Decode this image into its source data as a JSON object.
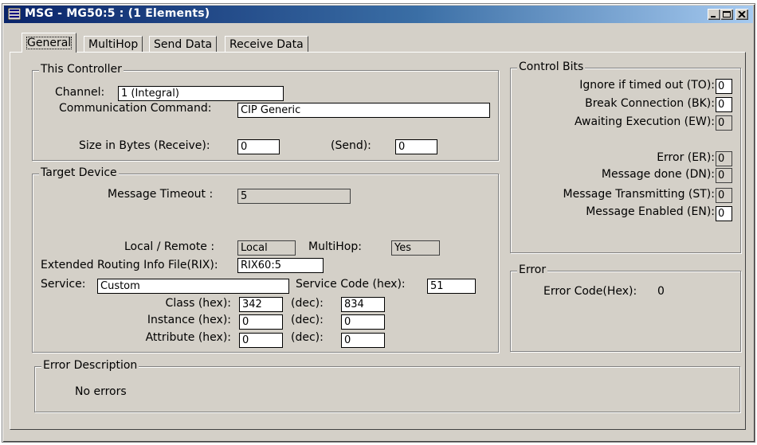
{
  "window": {
    "title": "MSG - MG50:5 : (1 Elements)"
  },
  "tabs": [
    {
      "label": "General"
    },
    {
      "label": "MultiHop"
    },
    {
      "label": "Send Data"
    },
    {
      "label": "Receive Data"
    }
  ],
  "this_controller": {
    "title": "This Controller",
    "channel_label": "Channel:",
    "channel_value": "1 (Integral)",
    "comm_command_label": "Communication Command:",
    "comm_command_value": "CIP Generic",
    "size_receive_label": "Size in Bytes (Receive):",
    "size_receive_value": "0",
    "size_send_label": "(Send):",
    "size_send_value": "0"
  },
  "target_device": {
    "title": "Target Device",
    "timeout_label": "Message Timeout :",
    "timeout_value": "5",
    "local_remote_label": "Local / Remote :",
    "local_remote_value": "Local",
    "multihop_label": "MultiHop:",
    "multihop_value": "Yes",
    "rix_label": "Extended Routing Info File(RIX):",
    "rix_value": "RIX60:5",
    "service_label": "Service:",
    "service_value": "Custom",
    "service_code_label": "Service Code (hex):",
    "service_code_value": "51",
    "class_label": "Class (hex):",
    "class_hex": "342",
    "class_dec_label": "(dec):",
    "class_dec": "834",
    "instance_label": "Instance (hex):",
    "instance_hex": "0",
    "instance_dec_label": "(dec):",
    "instance_dec": "0",
    "attribute_label": "Attribute (hex):",
    "attribute_hex": "0",
    "attribute_dec_label": "(dec):",
    "attribute_dec": "0"
  },
  "control_bits": {
    "title": "Control Bits",
    "items": [
      {
        "label": "Ignore if timed out (TO):",
        "value": "0"
      },
      {
        "label": "Break Connection (BK):",
        "value": "0"
      },
      {
        "label": "Awaiting Execution (EW):",
        "value": "0"
      },
      {
        "label": "Error (ER):",
        "value": "0"
      },
      {
        "label": "Message done (DN):",
        "value": "0"
      },
      {
        "label": "Message Transmitting (ST):",
        "value": "0"
      },
      {
        "label": "Message Enabled (EN):",
        "value": "0"
      }
    ]
  },
  "error": {
    "title": "Error",
    "code_label": "Error Code(Hex):",
    "code_value": "0"
  },
  "error_description": {
    "title": "Error Description",
    "text": "No errors"
  },
  "icons": {
    "app": "msg-icon",
    "minimize": "minimize-icon",
    "maximize": "maximize-icon",
    "close": "close-icon"
  },
  "colors": {
    "titlebar_start": "#0a246a",
    "titlebar_end": "#a6caf0",
    "face": "#d4d0c8"
  }
}
